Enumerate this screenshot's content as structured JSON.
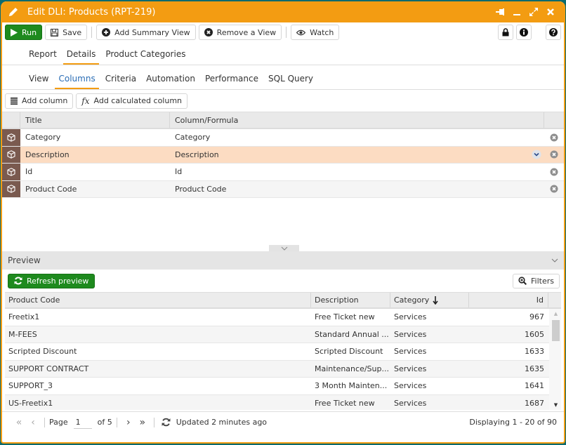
{
  "window": {
    "title": "Edit DLI: Products (RPT-219)",
    "accent": "#f39c12",
    "controls": [
      "pin-icon",
      "minimize-icon",
      "maximize-icon",
      "close-icon"
    ]
  },
  "toolbar": {
    "run": "Run",
    "save": "Save",
    "add_summary_view": "Add Summary View",
    "remove_view": "Remove a View",
    "watch": "Watch",
    "right_icons": [
      "lock-icon",
      "info-icon",
      "help-icon"
    ]
  },
  "tabs_primary": [
    {
      "label": "Report",
      "active": false
    },
    {
      "label": "Details",
      "active": true
    },
    {
      "label": "Product Categories",
      "active": false
    }
  ],
  "tabs_secondary": [
    {
      "label": "View",
      "active": false
    },
    {
      "label": "Columns",
      "active": true
    },
    {
      "label": "Criteria",
      "active": false
    },
    {
      "label": "Automation",
      "active": false
    },
    {
      "label": "Performance",
      "active": false
    },
    {
      "label": "SQL Query",
      "active": false
    }
  ],
  "column_tools": {
    "add_column": "Add column",
    "fx": "fx",
    "add_calculated": "Add calculated column"
  },
  "columns_grid": {
    "headers": [
      "Title",
      "Column/Formula"
    ],
    "rows": [
      {
        "title": "Category",
        "formula": "Category",
        "selected": false
      },
      {
        "title": "Description",
        "formula": "Description",
        "selected": true
      },
      {
        "title": "Id",
        "formula": "Id",
        "selected": false
      },
      {
        "title": "Product Code",
        "formula": "Product Code",
        "selected": false
      }
    ]
  },
  "preview": {
    "title": "Preview",
    "refresh": "Refresh preview",
    "filters": "Filters",
    "headers": [
      "Product Code",
      "Description",
      "Category",
      "Id"
    ],
    "sort": {
      "column": "Category",
      "direction": "descending"
    },
    "rows": [
      {
        "code": "Freetix1",
        "description": "Free Ticket new",
        "category": "Services",
        "id": "967"
      },
      {
        "code": "M-FEES",
        "description": "Standard Annual ...",
        "category": "Services",
        "id": "1605"
      },
      {
        "code": "Scripted Discount",
        "description": "Scripted Discount",
        "category": "Services",
        "id": "1633"
      },
      {
        "code": "SUPPORT CONTRACT",
        "description": "Maintenance/Sup...",
        "category": "Services",
        "id": "1635"
      },
      {
        "code": "SUPPORT_3",
        "description": "3 Month Mainten...",
        "category": "Services",
        "id": "1641"
      },
      {
        "code": "US-Freetix1",
        "description": "Free Ticket new",
        "category": "Services",
        "id": "1687"
      }
    ]
  },
  "pager": {
    "page_label": "Page",
    "page": "1",
    "of_label": "of 5",
    "updated": "Updated 2 minutes ago",
    "displaying": "Displaying 1 - 20 of 90"
  }
}
